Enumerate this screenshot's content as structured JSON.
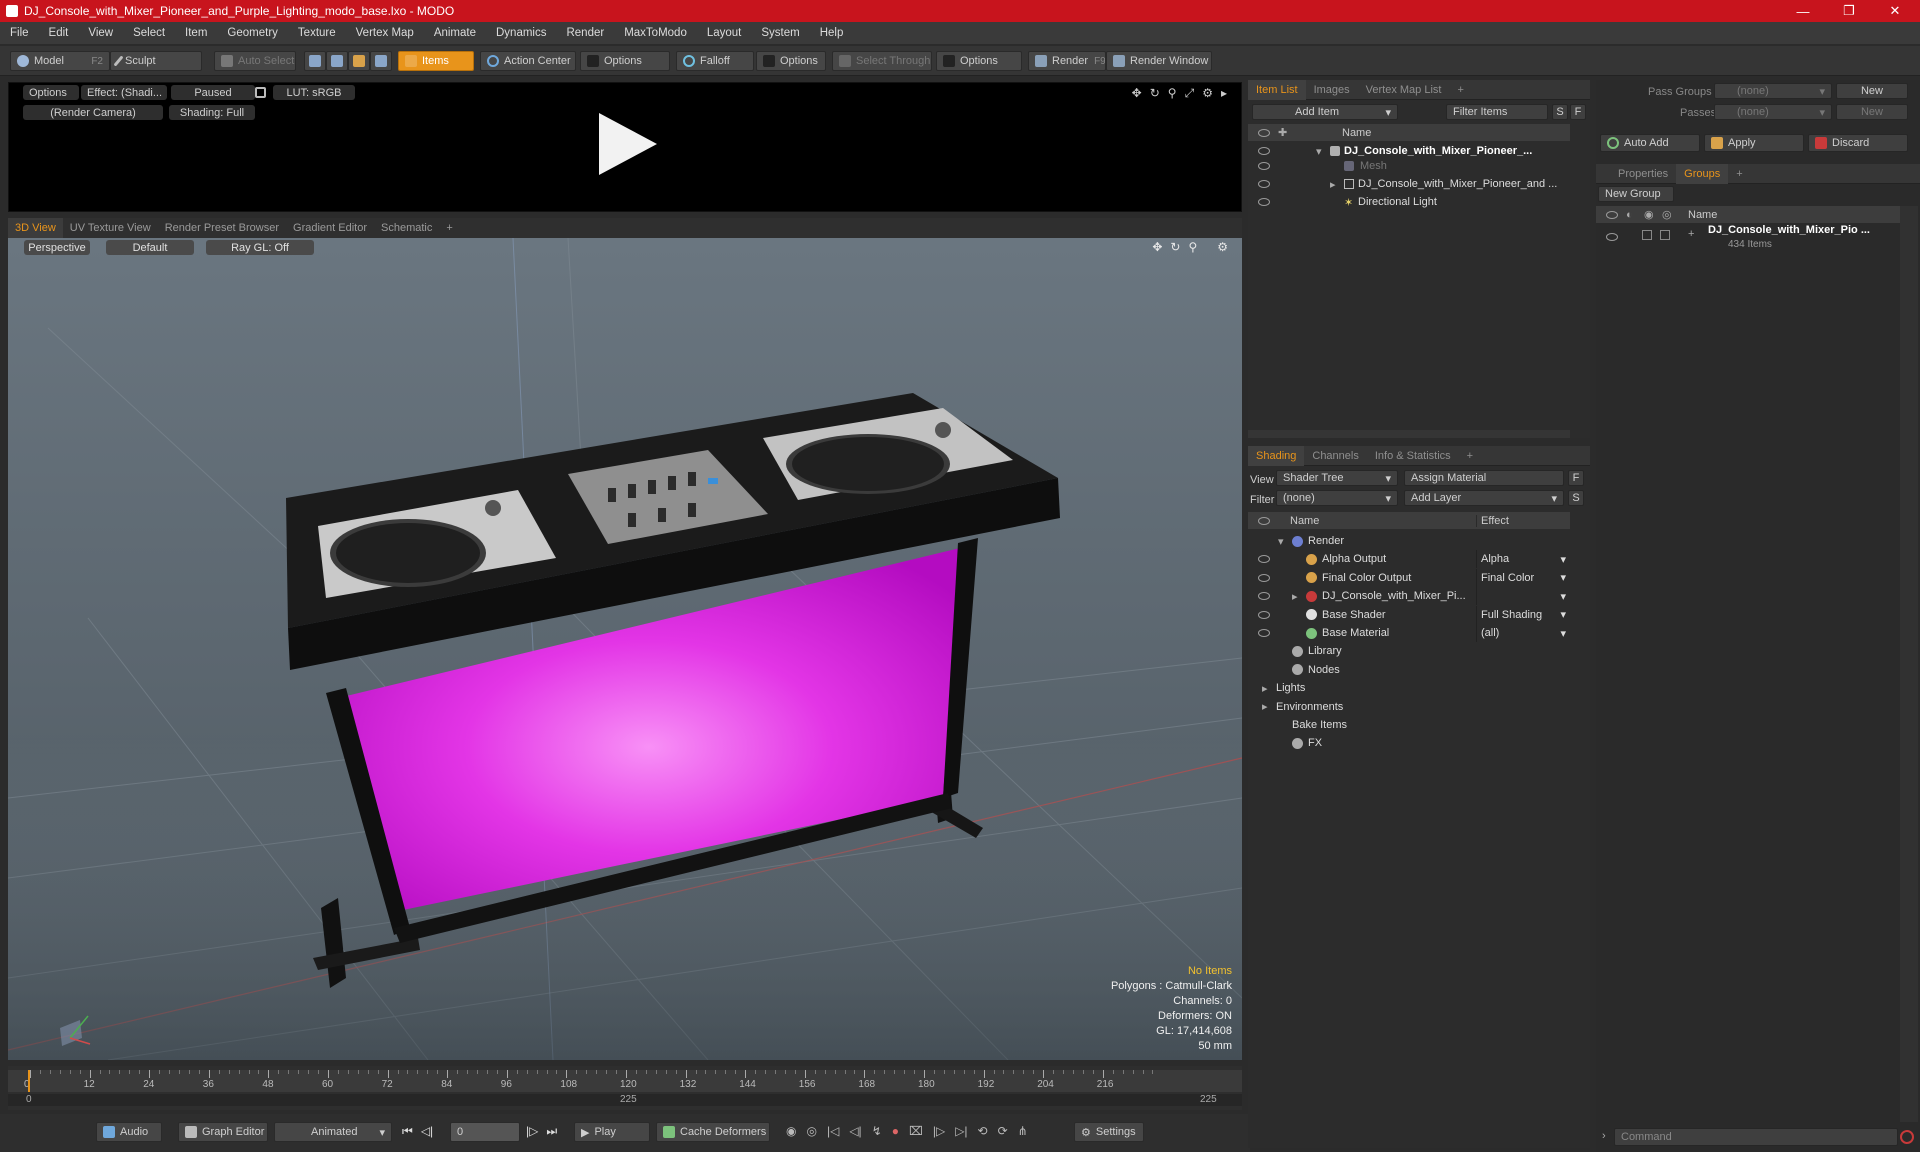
{
  "titlebar": {
    "title": "DJ_Console_with_Mixer_Pioneer_and_Purple_Lighting_modo_base.lxo - MODO",
    "minimize": "—",
    "maximize": "❐",
    "close": "✕"
  },
  "menu": [
    "File",
    "Edit",
    "View",
    "Select",
    "Item",
    "Geometry",
    "Texture",
    "Vertex Map",
    "Animate",
    "Dynamics",
    "Render",
    "MaxToModo",
    "Layout",
    "System",
    "Help"
  ],
  "toolbar": {
    "model": "Model",
    "model_key": "F2",
    "sculpt": "Sculpt",
    "auto_select": "Auto Select",
    "items": "Items",
    "action_center": "Action Center",
    "options1": "Options",
    "falloff": "Falloff",
    "options2": "Options",
    "select_through": "Select Through",
    "options3": "Options",
    "render": "Render",
    "render_key": "F9",
    "render_window": "Render Window"
  },
  "preview": {
    "options": "Options",
    "effect": "Effect: (Shadi...",
    "paused": "Paused",
    "lut": "LUT: sRGB",
    "camera": "(Render Camera)",
    "shading": "Shading: Full"
  },
  "view_tabs": [
    "3D View",
    "UV Texture View",
    "Render Preset Browser",
    "Gradient Editor",
    "Schematic",
    "+"
  ],
  "viewport": {
    "perspective": "Perspective",
    "default": "Default",
    "raygl": "Ray GL: Off",
    "info": {
      "items": "No Items",
      "polygons": "Polygons : Catmull-Clark",
      "channels": "Channels: 0",
      "deformers": "Deformers: ON",
      "gl": "GL: 17,414,608",
      "focal": "50 mm"
    }
  },
  "timeline": {
    "ticks": [
      "0",
      "12",
      "24",
      "36",
      "48",
      "60",
      "72",
      "84",
      "96",
      "108",
      "120",
      "132",
      "144",
      "156",
      "168",
      "180",
      "192",
      "204",
      "216"
    ],
    "start": "0",
    "mid": "225",
    "end": "225"
  },
  "bottombar": {
    "audio": "Audio",
    "graph_editor": "Graph Editor",
    "animated": "Animated",
    "frame": "0",
    "play": "Play",
    "cache": "Cache Deformers",
    "settings": "Settings"
  },
  "itemlist": {
    "tabs": [
      "Item List",
      "Images",
      "Vertex Map List",
      "+"
    ],
    "add_item": "Add Item",
    "filter": "Filter Items",
    "s": "S",
    "f": "F",
    "col_name": "Name",
    "rows": [
      "DJ_Console_with_Mixer_Pioneer_...",
      "Mesh",
      "DJ_Console_with_Mixer_Pioneer_and ...",
      "Directional Light"
    ]
  },
  "shading": {
    "tabs": [
      "Shading",
      "Channels",
      "Info & Statistics",
      "+"
    ],
    "view_label": "View",
    "view_value": "Shader Tree",
    "assign": "Assign Material",
    "f": "F",
    "filter_label": "Filter",
    "filter_value": "(none)",
    "add_layer": "Add Layer",
    "s": "S",
    "col_name": "Name",
    "col_effect": "Effect",
    "rows": [
      {
        "name": "Render",
        "effect": ""
      },
      {
        "name": "Alpha Output",
        "effect": "Alpha"
      },
      {
        "name": "Final Color Output",
        "effect": "Final Color"
      },
      {
        "name": "DJ_Console_with_Mixer_Pi...",
        "effect": ""
      },
      {
        "name": "Base Shader",
        "effect": "Full Shading"
      },
      {
        "name": "Base Material",
        "effect": "(all)"
      },
      {
        "name": "Library",
        "effect": ""
      },
      {
        "name": "Nodes",
        "effect": ""
      },
      {
        "name": "Lights",
        "effect": ""
      },
      {
        "name": "Environments",
        "effect": ""
      },
      {
        "name": "Bake Items",
        "effect": ""
      },
      {
        "name": "FX",
        "effect": ""
      }
    ]
  },
  "groups": {
    "pass_groups": "Pass Groups",
    "passes": "Passes",
    "none1": "(none)",
    "none2": "(none)",
    "new1": "New",
    "new2": "New",
    "auto_add": "Auto Add",
    "apply": "Apply",
    "discard": "Discard",
    "tabs": [
      "Properties",
      "Groups",
      "+"
    ],
    "new_group": "New Group",
    "col_name": "Name",
    "group_name": "DJ_Console_with_Mixer_Pio ...",
    "group_count": "434 Items"
  },
  "command": {
    "placeholder": "Command"
  }
}
